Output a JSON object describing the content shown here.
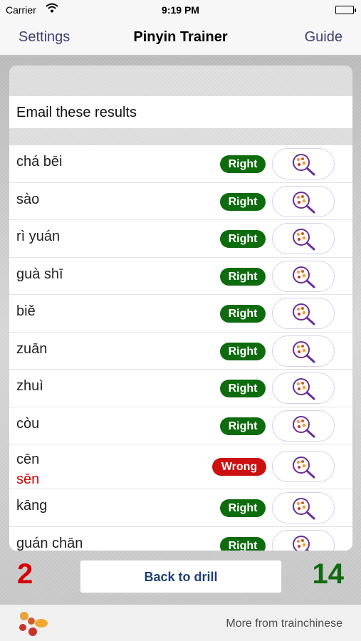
{
  "status_bar": {
    "carrier": "Carrier",
    "time": "9:19 PM"
  },
  "nav": {
    "left": "Settings",
    "title": "Pinyin Trainer",
    "right": "Guide"
  },
  "email_label": "Email these results",
  "results": [
    {
      "pinyin": "chá bēi",
      "status": "Right"
    },
    {
      "pinyin": "sào",
      "status": "Right"
    },
    {
      "pinyin": "rì yuán",
      "status": "Right"
    },
    {
      "pinyin": "guà shī",
      "status": "Right"
    },
    {
      "pinyin": "biě",
      "status": "Right"
    },
    {
      "pinyin": "zuān",
      "status": "Right"
    },
    {
      "pinyin": "zhuì",
      "status": "Right"
    },
    {
      "pinyin": "còu",
      "status": "Right"
    },
    {
      "pinyin": "cēn",
      "correction": "sēn",
      "status": "Wrong"
    },
    {
      "pinyin": "kāng",
      "status": "Right"
    },
    {
      "pinyin": "guán chān",
      "status": "Right"
    }
  ],
  "score": {
    "wrong": "2",
    "right": "14"
  },
  "back_button": "Back to drill",
  "footer": {
    "more": "More from trainchinese"
  },
  "colors": {
    "right": "#0e6b0e",
    "wrong": "#cc1010",
    "accent": "#3d3f70"
  },
  "icons": {
    "lookup": "magnifier-icon",
    "logo": "trainchinese-logo"
  }
}
